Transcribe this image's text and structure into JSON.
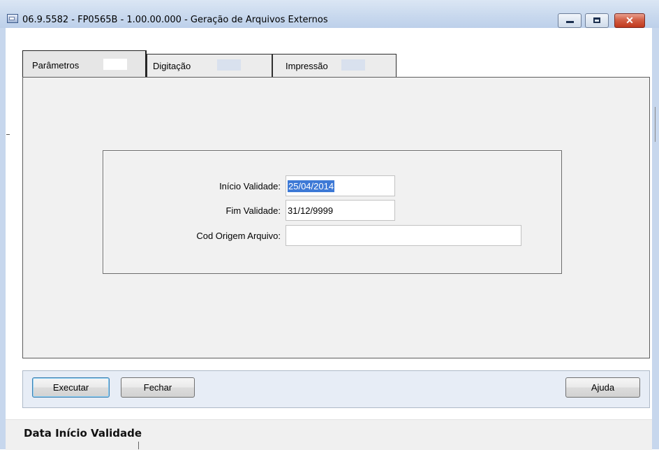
{
  "window": {
    "title": "06.9.5582 - FP0565B - 1.00.00.000 - Geração de Arquivos Externos",
    "buttons": {
      "minimize": "minimize-icon",
      "maximize": "maximize-icon",
      "close": "close-icon"
    }
  },
  "tabs": [
    {
      "label": "Parâmetros",
      "active": true
    },
    {
      "label": "Digitação",
      "active": false
    },
    {
      "label": "Impressão",
      "active": false
    }
  ],
  "form": {
    "inicio_validade": {
      "label": "Início Validade:",
      "value": "25/04/2014"
    },
    "fim_validade": {
      "label": "Fim Validade:",
      "value": "31/12/9999"
    },
    "cod_origem": {
      "label": "Cod Origem Arquivo:",
      "value": ""
    }
  },
  "actions": {
    "execute": "Executar",
    "close": "Fechar",
    "help": "Ajuda"
  },
  "status": {
    "text": "Data Início Validade"
  },
  "colors": {
    "titlebar": "#c9d9ee",
    "selection": "#3d79d6",
    "close_button": "#c0381c",
    "button_bar": "#e7edf6"
  }
}
